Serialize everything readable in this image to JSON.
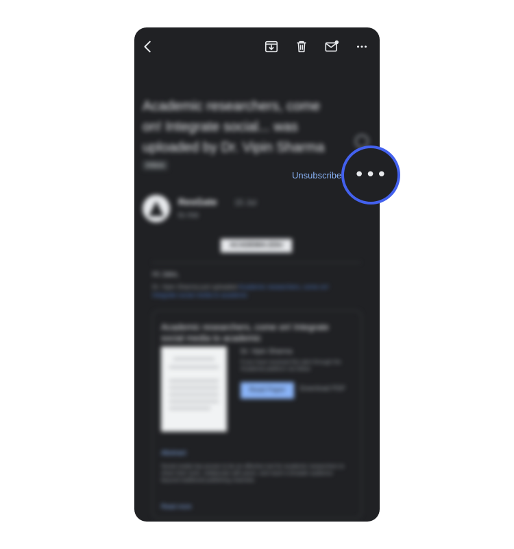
{
  "toolbar": {
    "back": "back-arrow-icon",
    "archive": "archive-icon",
    "delete": "trash-icon",
    "mark_unread": "mark-unread-icon",
    "more": "more-horizontal-icon"
  },
  "email": {
    "subject": "Academic researchers, come on! Integrate social... was uploaded by Dr. Vipin Sharma",
    "label": "Inbox",
    "sender": "ResGate",
    "time": "15 Jul",
    "to": "to me",
    "unsubscribe_label": "Unsubscribe",
    "brand_pill": "ACADEMIA.EDU",
    "greeting": "Hi Jake,",
    "notice_text": "Dr. Vipin Sharma just uploaded",
    "notice_link": "Academic researchers, come on! Integrate social media to academic",
    "card": {
      "title": "Academic researchers, come on! Integrate social media to academic",
      "author": "Dr. Vipin Sharma",
      "description": "If you have received this alert through the Academia platform via follow",
      "read_button": "Read Paper",
      "download_button": "Download PDF",
      "abstract_label": "Abstract",
      "abstract_text": "Social media has proven to be an effective tool for academic researchers to share their work, collaborate with peers, and reach a broader audience beyond traditional publishing channels.",
      "read_more": "Read more"
    }
  },
  "highlight": {
    "more_options": "•••",
    "ring_color": "#4361ee"
  }
}
